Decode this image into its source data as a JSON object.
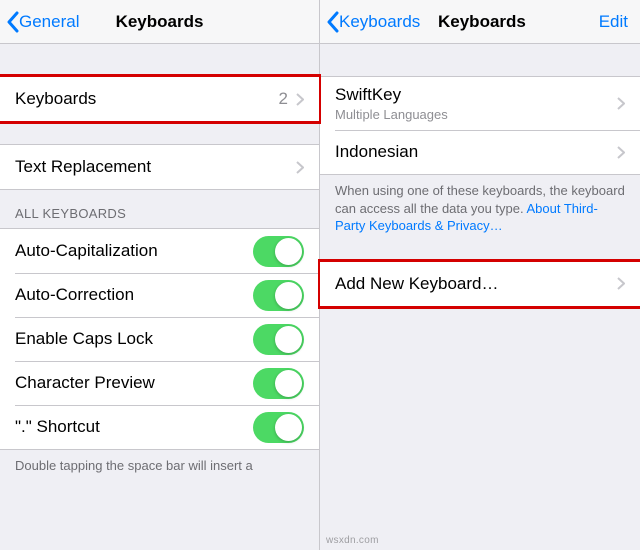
{
  "left": {
    "nav": {
      "back": "General",
      "title": "Keyboards"
    },
    "keyboards_row": {
      "label": "Keyboards",
      "count": "2"
    },
    "text_replacement": {
      "label": "Text Replacement"
    },
    "section_header": "ALL KEYBOARDS",
    "toggles": [
      {
        "label": "Auto-Capitalization"
      },
      {
        "label": "Auto-Correction"
      },
      {
        "label": "Enable Caps Lock"
      },
      {
        "label": "Character Preview"
      },
      {
        "label": "\".\" Shortcut"
      }
    ],
    "footer": "Double tapping the space bar will insert a"
  },
  "right": {
    "nav": {
      "back": "Keyboards",
      "title": "Keyboards",
      "edit": "Edit"
    },
    "keyboards": [
      {
        "label": "SwiftKey",
        "sub": "Multiple Languages"
      },
      {
        "label": "Indonesian"
      }
    ],
    "footer_text": "When using one of these keyboards, the keyboard can access all the data you type. ",
    "footer_link": "About Third-Party Keyboards & Privacy…",
    "add_new": {
      "label": "Add New Keyboard…"
    }
  },
  "watermark": "wsxdn.com"
}
